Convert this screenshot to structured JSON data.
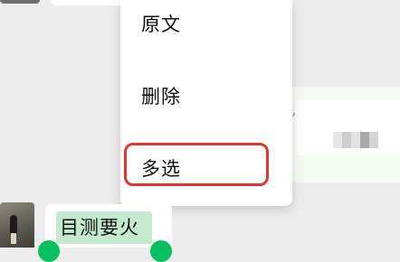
{
  "context_menu": {
    "items": [
      {
        "label": "原文"
      },
      {
        "label": "删除"
      },
      {
        "label": "多选"
      }
    ]
  },
  "chat": {
    "selected_message_text": "目测要火"
  },
  "colors": {
    "highlight_border": "#e0362c",
    "selection_fill": "#c4e9cc",
    "selection_handle": "#07c160",
    "background": "#ededed"
  }
}
